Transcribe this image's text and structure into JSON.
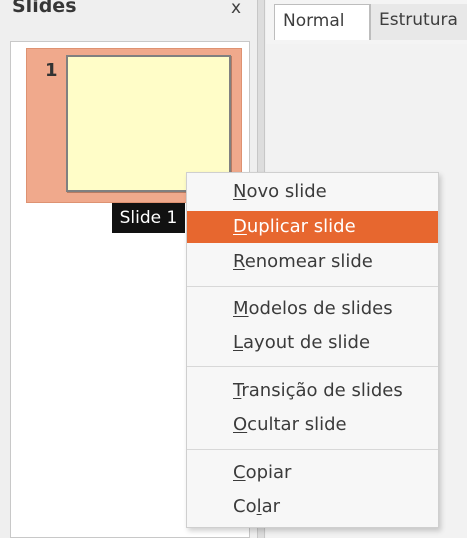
{
  "slides_panel": {
    "title": "Slides",
    "close_label": "x",
    "slide_number": "1",
    "tooltip": "Slide 1"
  },
  "tabs": [
    {
      "label": "Normal"
    },
    {
      "label": "Estrutura"
    }
  ],
  "context_menu": {
    "items": [
      {
        "prefix": "",
        "mnemonic": "N",
        "suffix": "ovo slide"
      },
      {
        "prefix": "",
        "mnemonic": "D",
        "suffix": "uplicar slide"
      },
      {
        "prefix": "",
        "mnemonic": "R",
        "suffix": "enomear slide"
      },
      {
        "prefix": "",
        "mnemonic": "M",
        "suffix": "odelos de slides"
      },
      {
        "prefix": "",
        "mnemonic": "L",
        "suffix": "ayout de slide"
      },
      {
        "prefix": "",
        "mnemonic": "T",
        "suffix": "ransição de slides"
      },
      {
        "prefix": "",
        "mnemonic": "O",
        "suffix": "cultar slide"
      },
      {
        "prefix": "",
        "mnemonic": "C",
        "suffix": "opiar"
      },
      {
        "prefix": "Co",
        "mnemonic": "l",
        "suffix": "ar"
      }
    ]
  },
  "colors": {
    "menu_highlight": "#e7672f",
    "slide_selection": "#f0a98c",
    "slide_thumbnail": "#fffdc8"
  }
}
